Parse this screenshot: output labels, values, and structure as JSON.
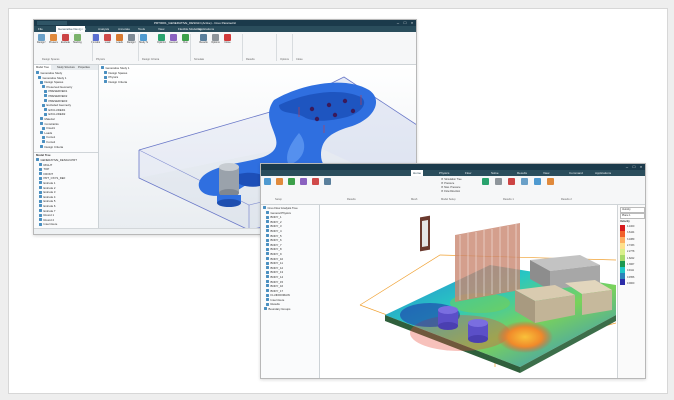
{
  "window1": {
    "title": "PRT0001_GENERATIVE_DESIGN (Active) - Creo Parametric",
    "tabs": [
      "File",
      "Generative Design",
      "Model",
      "Analysis",
      "Annotate",
      "Tools",
      "View",
      "Flexible Modeling",
      "Applications"
    ],
    "ribbon": {
      "buttons": [
        {
          "label": "Design Space",
          "icon_color": "#6aa0c8"
        },
        {
          "label": "Preserved Geometry",
          "icon_color": "#e08a3c"
        },
        {
          "label": "Excluded Geometry",
          "icon_color": "#c44"
        },
        {
          "label": "Starting Geometry",
          "icon_color": "#7bb36b"
        },
        {
          "label": "Constraint",
          "icon_color": "#5a6ed0"
        },
        {
          "label": "Load",
          "icon_color": "#d04a4a"
        },
        {
          "label": "Loads",
          "icon_color": "#d87a30"
        },
        {
          "label": "Design Criteria",
          "icon_color": "#7e8a94"
        },
        {
          "label": "Study Settings",
          "icon_color": "#4f9ad0"
        },
        {
          "label": "Optimize",
          "icon_color": "#2aa36e"
        },
        {
          "label": "Geometry",
          "icon_color": "#8a62c0"
        },
        {
          "label": "Run",
          "icon_color": "#3ca04a"
        },
        {
          "label": "Results",
          "icon_color": "#5a7f9c"
        },
        {
          "label": "Options",
          "icon_color": "#8e959b"
        },
        {
          "label": "Close",
          "icon_color": "#d23a3a"
        }
      ],
      "groups": [
        "Design Spaces",
        "Physics",
        "Design Criteria",
        "Simulate",
        "Results",
        "Options",
        "Close"
      ]
    },
    "panel_tabs": [
      "Model Tree",
      "Study Structure",
      "Properties"
    ],
    "tree_items": [
      "Generative Study",
      "Generative Study 1",
      "Design Spaces",
      "Preserved Geometry",
      "PRESERVED1",
      "PRESERVED2",
      "PRESERVED3",
      "Excluded Geometry",
      "EXCLUDED1",
      "EXCLUDED2",
      "Material",
      "Constraints",
      "Fixed1",
      "Loads",
      "Force1",
      "Force2",
      "Design Criteria"
    ],
    "lower_title": "Model Tree",
    "lower_items": [
      "GENERATIVE_DESIGN.PRT",
      "RIGHT",
      "TOP",
      "FRONT",
      "PRT_CSYS_DEF",
      "Extrude 1",
      "Extrude 2",
      "Extrude 3",
      "Extrude 4",
      "Extrude 5",
      "Extrude 6",
      "Extrude 7",
      "Round 1",
      "Round 2",
      "Insert Here"
    ],
    "center_items": [
      "Generative Study 1",
      "Design Spaces",
      "Physics",
      "Design Criteria"
    ],
    "status_text": "Smart Select"
  },
  "window2": {
    "title": "",
    "tabs": [
      "Home",
      "Physics",
      "Flow",
      "Solve",
      "Results",
      "View",
      "Command",
      "Applications"
    ],
    "ribbon": {
      "groups": [
        "Setup",
        "Results",
        "Mesh",
        "Model Setup",
        "Results 1",
        "Results 2"
      ],
      "checklist": [
        "Simulation Tree",
        "Pressure",
        "Max. Pressure",
        "Flow Direction"
      ]
    },
    "tree_items": [
      "Creo Flow Analysis Tree",
      "General Physics",
      "BODY_1",
      "BODY_2",
      "BODY_3",
      "BODY_4",
      "BODY_5",
      "BODY_6",
      "BODY_7",
      "BODY_8",
      "BODY_9",
      "BODY_10",
      "BODY_11",
      "BODY_12",
      "BODY_13",
      "BODY_14",
      "BODY_15",
      "BODY_16",
      "BODY_17",
      "FLUIDDOMAIN",
      "Insert Here",
      "Results",
      "Boundary Groups"
    ],
    "legend": {
      "title": "Velocity",
      "values": [
        "4.1000",
        "3.6444",
        "3.1889",
        "2.7333",
        "2.2778",
        "1.8222",
        "1.3667",
        "0.9111",
        "0.4556",
        "0.0000"
      ],
      "colors": [
        "#d7191c",
        "#f1602a",
        "#fdae61",
        "#fee08b",
        "#d9ef8b",
        "#a6d96a",
        "#1a9850",
        "#1ec7c7",
        "#2b83ba",
        "#2c2ca8"
      ]
    },
    "right_selects": [
      "Velocity",
      "Plane 1"
    ]
  }
}
